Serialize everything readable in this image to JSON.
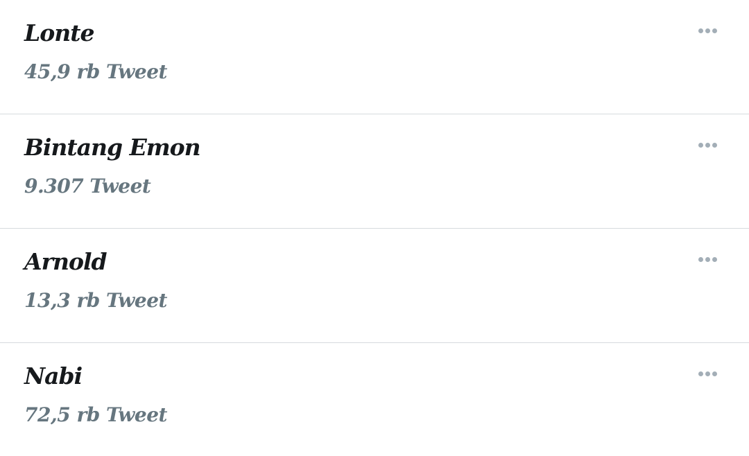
{
  "trends": [
    {
      "name": "Lonte",
      "count": "45,9 rb Tweet"
    },
    {
      "name": "Bintang Emon",
      "count": "9.307 Tweet"
    },
    {
      "name": "Arnold",
      "count": "13,3 rb Tweet"
    },
    {
      "name": "Nabi",
      "count": "72,5 rb Tweet"
    }
  ],
  "icons": {
    "more": "more-options-icon"
  },
  "colors": {
    "name_text": "#16191c",
    "count_text": "#66767f",
    "icon": "#a3aeb7",
    "divider": "#d6dade"
  }
}
